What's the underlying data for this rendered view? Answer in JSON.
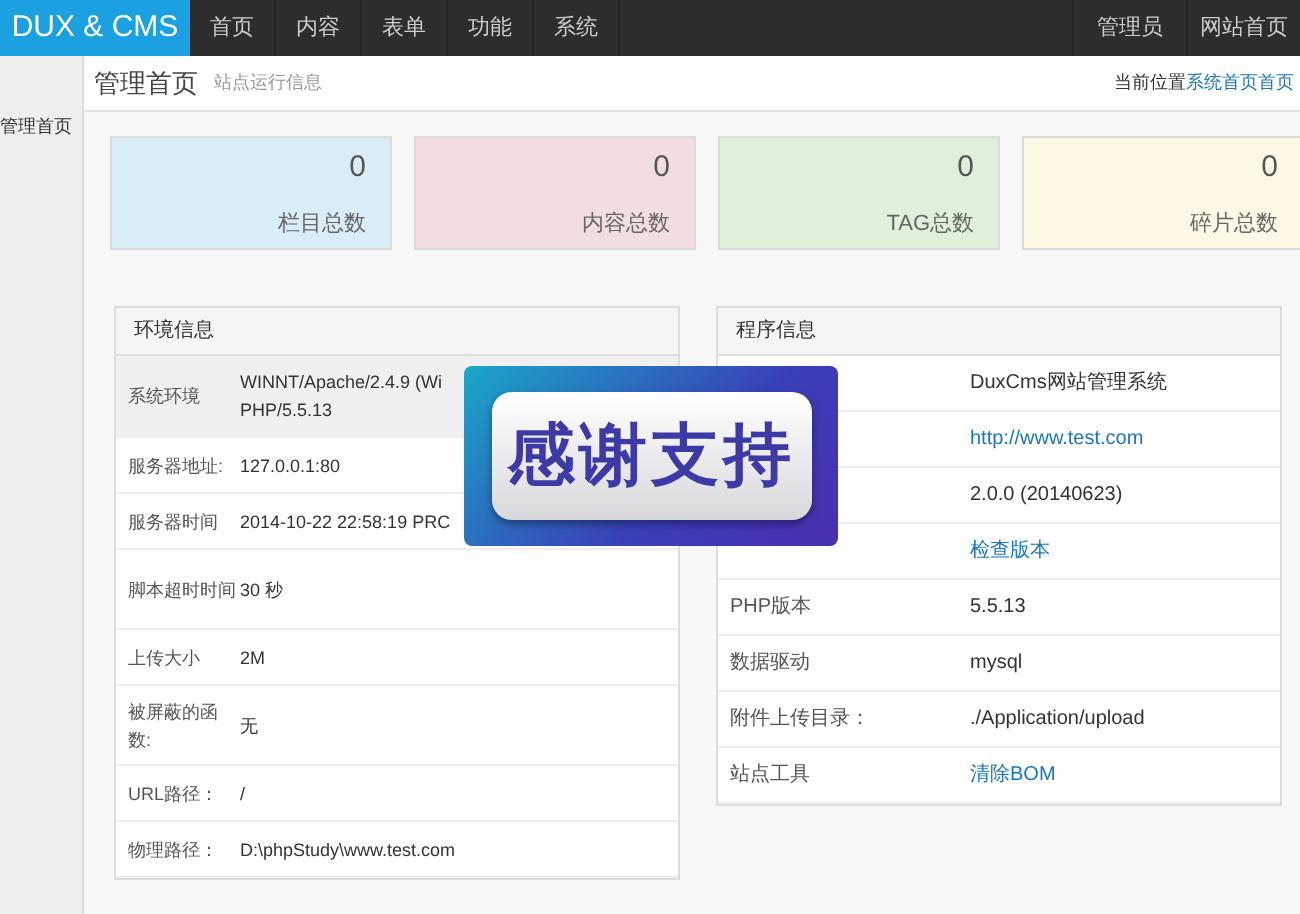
{
  "logo": "DUX & CMS",
  "nav": [
    {
      "label": "首页"
    },
    {
      "label": "内容"
    },
    {
      "label": "表单"
    },
    {
      "label": "功能"
    },
    {
      "label": "系统"
    }
  ],
  "nav_right": [
    {
      "label": "管理员"
    },
    {
      "label": "网站首页"
    }
  ],
  "sidebar": {
    "items": [
      {
        "label": "管理首页",
        "selected": true
      }
    ]
  },
  "header": {
    "title": "管理首页",
    "subtitle": "站点运行信息",
    "breadcrumb_label": "当前位置",
    "breadcrumb_links": [
      "系统首页",
      "首页"
    ]
  },
  "stats": [
    {
      "value": "0",
      "label": "栏目总数",
      "color": "#d9edf7"
    },
    {
      "value": "0",
      "label": "内容总数",
      "color": "#f2dede"
    },
    {
      "value": "0",
      "label": "TAG总数",
      "color": "#dff0d8"
    },
    {
      "value": "0",
      "label": "碎片总数",
      "color": "#fcf8e3"
    }
  ],
  "env_panel": {
    "title": "环境信息",
    "rows": [
      {
        "label": "系统环境",
        "value": "WINNT/Apache/2.4.9 (Wi",
        "value_2": "PHP/5.5.13",
        "shaded": true
      },
      {
        "label": "服务器地址:",
        "value": "127.0.0.1:80",
        "shaded": false
      },
      {
        "label": "服务器时间",
        "value": "2014-10-22 22:58:19 PRC",
        "shaded": false
      },
      {
        "label": "脚本超时时间",
        "value": "30 秒",
        "shaded": false
      },
      {
        "label": "上传大小",
        "value": "2M",
        "shaded": false
      },
      {
        "label": "被屏蔽的函数:",
        "value": "无",
        "shaded": false
      },
      {
        "label": "URL路径：",
        "value": "/",
        "shaded": false
      },
      {
        "label": "物理路径：",
        "value": "D:\\phpStudy\\www.test.com",
        "shaded": false
      }
    ]
  },
  "program_panel": {
    "title": "程序信息",
    "rows": [
      {
        "value": "DuxCms网站管理系统",
        "kind": "text"
      },
      {
        "value": "http://www.test.com",
        "kind": "link"
      },
      {
        "value": "2.0.0 (20140623)",
        "kind": "text"
      },
      {
        "value": "检查版本",
        "kind": "link"
      },
      {
        "label": "PHP版本",
        "value": "5.5.13",
        "kind": "text"
      },
      {
        "label": "数据驱动",
        "value": "mysql",
        "kind": "text"
      },
      {
        "label": "附件上传目录：",
        "value": "./Application/upload",
        "kind": "text"
      },
      {
        "label": "站点工具",
        "value": "清除BOM",
        "kind": "link"
      }
    ]
  },
  "banner": {
    "text": "感谢支持"
  }
}
